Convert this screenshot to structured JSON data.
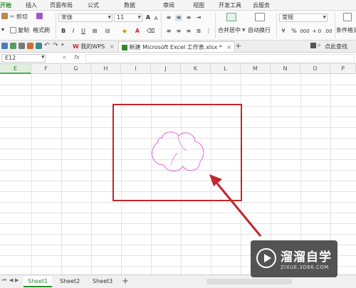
{
  "menu": {
    "tabs": [
      "开始",
      "插入",
      "页面布局",
      "公式",
      "数据",
      "审阅",
      "视图",
      "开发工具",
      "云服务"
    ],
    "active": "开始"
  },
  "ribbon": {
    "cut": "剪切",
    "copy": "复制",
    "format_painter": "格式刷",
    "font_name": "宋体",
    "font_size": "11",
    "merge_center": "合并居中",
    "wrap_text": "自动换行",
    "number_format": "常规",
    "conditional_format": "条件格式",
    "percent": "%",
    "thousands": "000",
    "dec_inc": "+.0",
    "dec_dec": ".00"
  },
  "tabbar": {
    "tabs": [
      {
        "label": "我的WPS",
        "close": "×"
      },
      {
        "label": "新建 Microsoft Excel 工作表.xlsx *",
        "close": "×"
      }
    ],
    "new_tab": "+",
    "search": "点此查找"
  },
  "formula": {
    "cell_ref": "E12",
    "fx": "fx",
    "zoom_icon": "magnifier-icon"
  },
  "grid": {
    "columns": [
      "E",
      "F",
      "G",
      "H",
      "I",
      "J",
      "K",
      "L",
      "M",
      "N",
      "O",
      "P"
    ],
    "selected_column": "E"
  },
  "sheets": {
    "tabs": [
      "Sheet1",
      "Sheet2",
      "Sheet3"
    ],
    "active": "Sheet1",
    "add": "+"
  },
  "watermark": {
    "brand": "溜溜自学",
    "domain": "ZIXUE.3D66.COM"
  },
  "colors": {
    "accent_green": "#2e8b2e",
    "highlight_red": "#c0272d",
    "cloud_stroke": "#e040e0"
  }
}
